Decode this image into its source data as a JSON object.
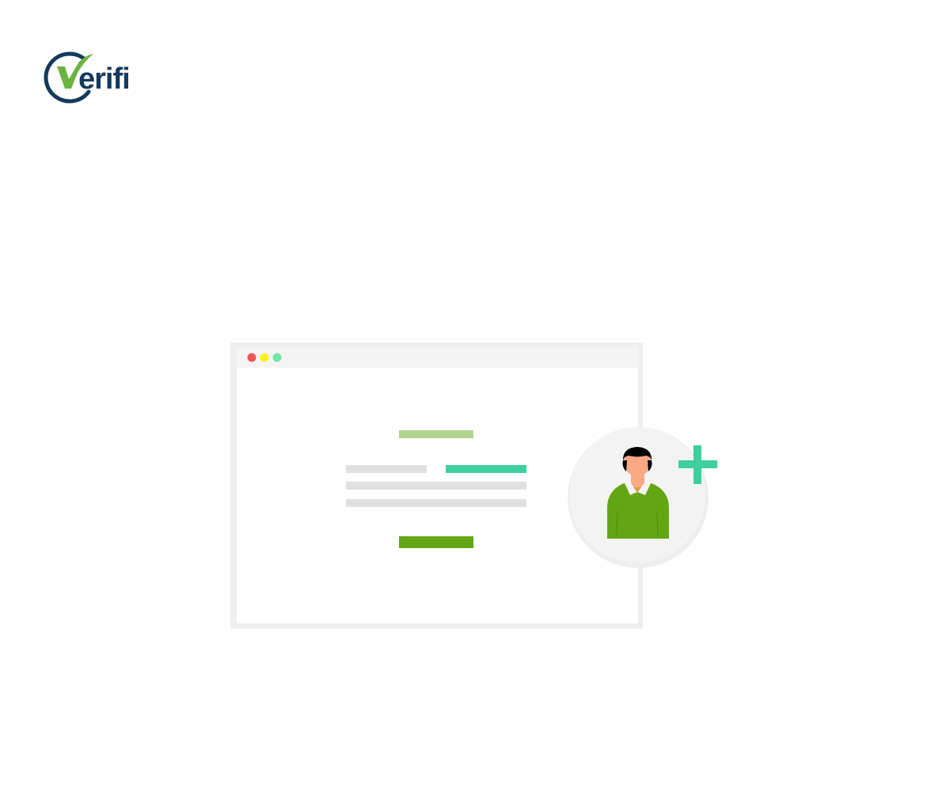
{
  "brand": {
    "logo_text": "erifi",
    "logo_mark": "V",
    "navy": "#143a5c",
    "green": "#6db33f"
  },
  "illustration": {
    "name": "add-user-illustration",
    "icons": [
      "window-close-dot-icon",
      "window-minimize-dot-icon",
      "window-maximize-dot-icon",
      "user-avatar-icon",
      "plus-icon"
    ],
    "colors": {
      "frame": "#efefef",
      "titlebar": "#f3f3f3",
      "dot_red": "#f05454",
      "dot_yellow": "#f7f21c",
      "dot_green": "#6ee7a6",
      "title_bar_placeholder": "#b1d28c",
      "placeholder_gray": "#e0e0e0",
      "placeholder_teal": "#3ecf9c",
      "button_green": "#63a513",
      "avatar_bg": "#f2f2f2",
      "skin": "#fba884",
      "hair": "#000000",
      "shirt": "#63a513",
      "plus": "#3ecf9c"
    }
  }
}
